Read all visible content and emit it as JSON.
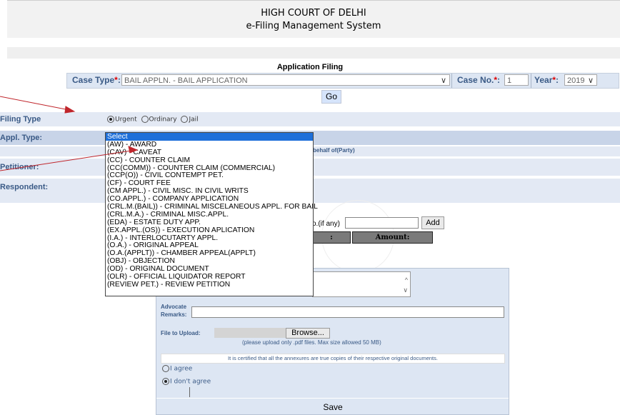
{
  "header": {
    "title": "HIGH COURT OF DELHI",
    "subtitle": "e-Filing Management System"
  },
  "form": {
    "title": "Application Filing",
    "case_type_label": "Case Type",
    "case_type_value": "BAIL APPLN. - BAIL APPLICATION",
    "case_no_label": "Case No.",
    "case_no_value": "1",
    "year_label": "Year",
    "year_value": "2019",
    "required_mark": "*",
    "colon": ":",
    "go_label": "Go"
  },
  "filing_type": {
    "label": "Filing Type",
    "options": [
      {
        "label": "Urgent",
        "selected": true
      },
      {
        "label": "Ordinary",
        "selected": false
      },
      {
        "label": "Jail",
        "selected": false
      }
    ]
  },
  "appl_type_label": "Appl. Type:",
  "petitioner_label": "Petitioner:",
  "respondent_label": "Respondent:",
  "behalf_text": "behalf of(Party)",
  "add": {
    "prefix": "o.(if any)",
    "button": "Add",
    "amount_header": "Amount:",
    "colon_header": ":"
  },
  "dropdown": {
    "options": [
      "Select",
      "(AW) - AWARD",
      "(CAV) - CAVEAT",
      "(CC) - COUNTER CLAIM",
      "(CC(COMM)) - COUNTER CLAIM (COMMERCIAL)",
      "(CCP(O)) - CIVIL CONTEMPT PET.",
      "(CF) - COURT FEE",
      "(CM APPL.) - CIVIL MISC. IN CIVIL WRITS",
      "(CO.APPL.) - COMPANY APPLICATION",
      "(CRL.M.(BAIL)) - CRIMINAL MISCELANEOUS APPL. FOR BAIL",
      "(CRL.M.A.) - CRIMINAL MISC.APPL.",
      "(EDA) - ESTATE DUTY APP.",
      "(EX.APPL.(OS)) - EXECUTION APLICATION",
      "(I.A.) - INTERLOCUTARTY APPL.",
      "(O.A.) - ORIGINAL APPEAL",
      "(O.A.(APPLT)) - CHAMBER APPEAL(APPLT)",
      "(OBJ) - OBJECTION",
      "(OD) - ORIGINAL DOCUMENT",
      "(OLR) - OFFICIAL LIQUIDATOR REPORT",
      "(REVIEW PET.) - REVIEW PETITION"
    ],
    "selected_index": 0
  },
  "panel": {
    "advocate_label": "Advocate",
    "remarks_label": "Remarks:",
    "file_label": "File to Upload:",
    "browse": "Browse...",
    "upload_note": "(please upload only .pdf files. Max size allowed 50 MB)",
    "certify": "It is certified that all the annexures are true copies of their respective original documents.",
    "agree": "I agree",
    "disagree": "I don't agree",
    "save": "Save"
  },
  "colors": {
    "accent_label": "#3a5a86",
    "panel_bg": "#dde6f3",
    "select_highlight": "#1e6fd9",
    "arrow": "#c0262c"
  }
}
